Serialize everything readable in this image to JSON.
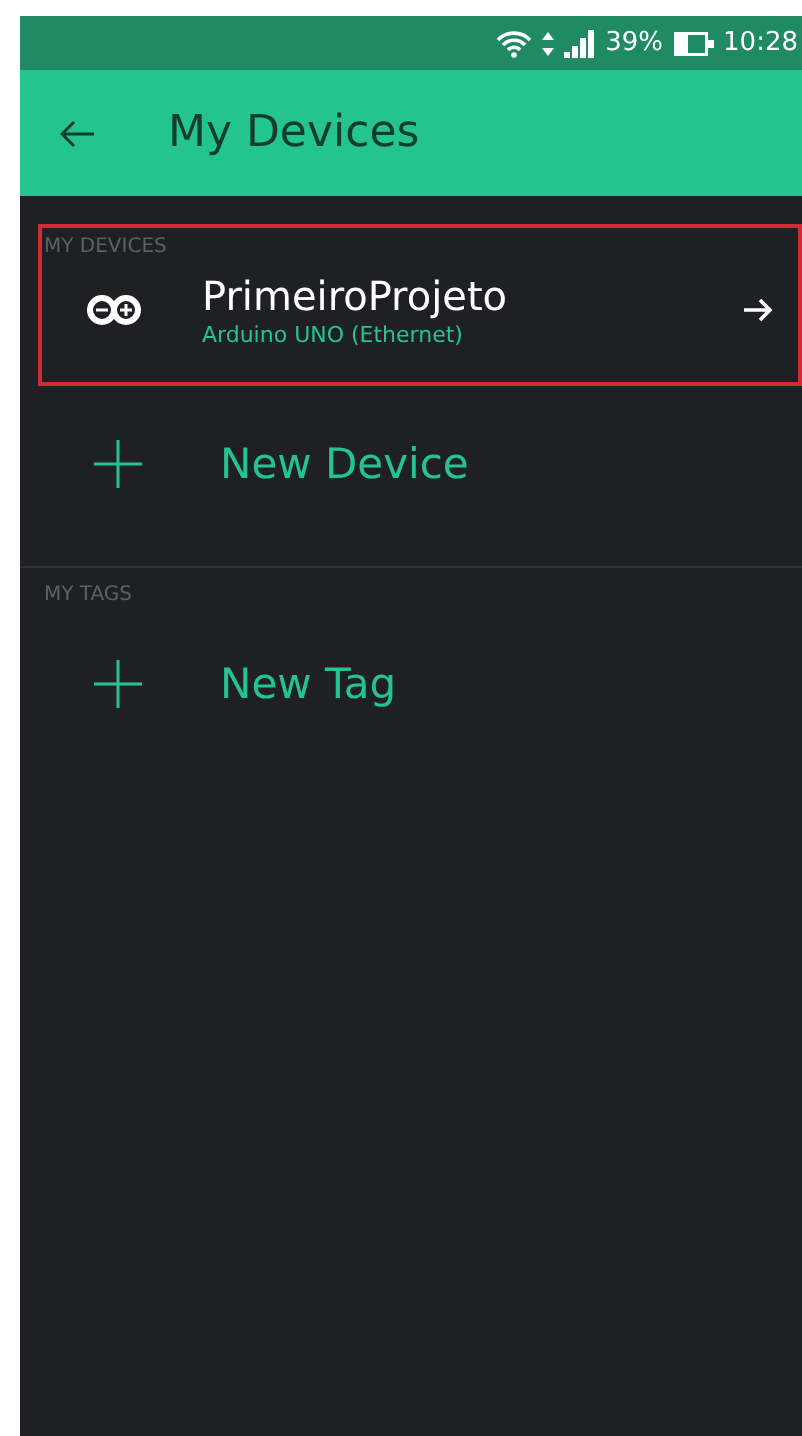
{
  "status_bar": {
    "battery": "39%",
    "time": "10:28"
  },
  "app_bar": {
    "title": "My Devices"
  },
  "sections": [
    {
      "heading": "MY DEVICES",
      "devices": [
        {
          "name": "PrimeiroProjeto",
          "board": "Arduino UNO (Ethernet)",
          "highlighted": true
        }
      ],
      "add_label": "New Device"
    },
    {
      "heading": "MY TAGS",
      "add_label": "New Tag"
    }
  ]
}
